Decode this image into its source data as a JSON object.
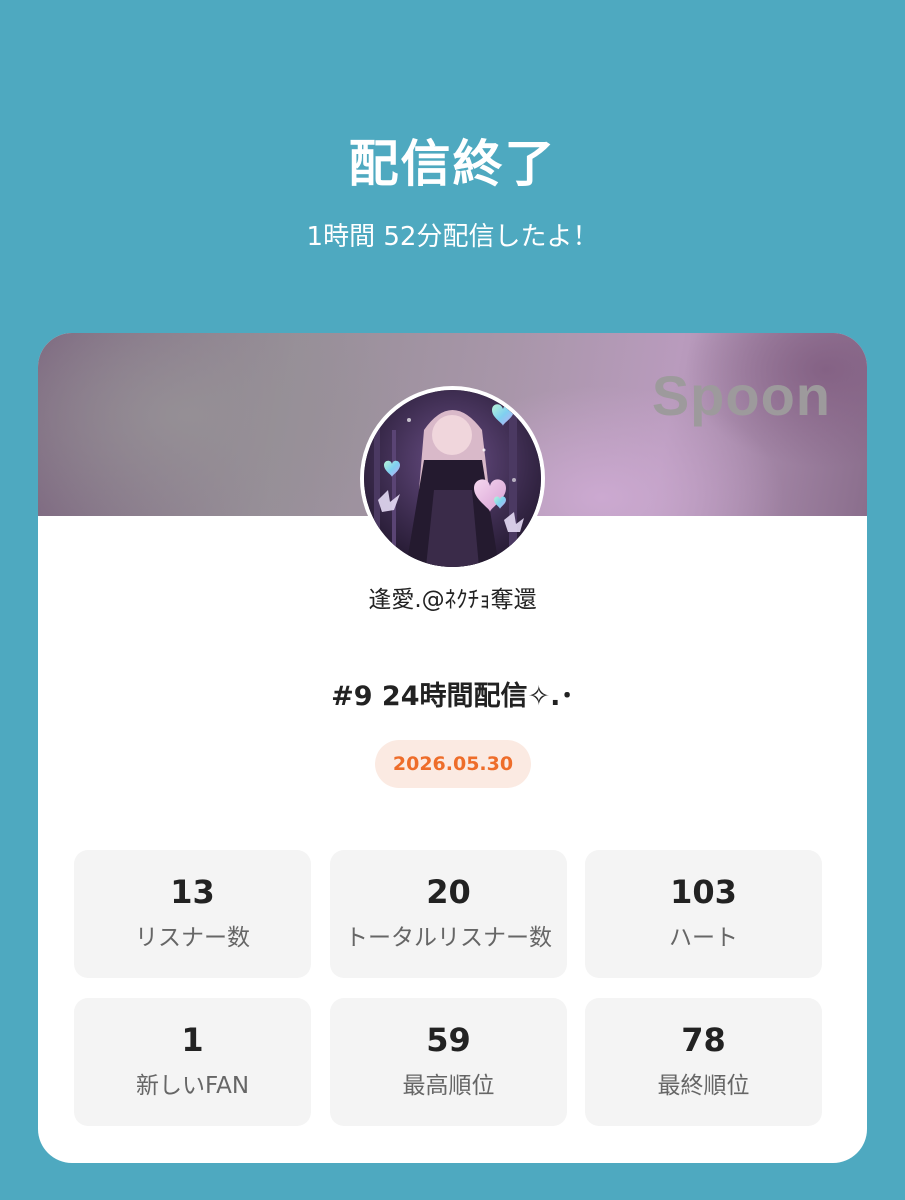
{
  "header": {
    "title": "配信終了",
    "duration_text": "1時間 52分配信したよ！"
  },
  "card": {
    "brand_text": "Spoon",
    "username": "逢愛.@ﾈｸﾁｮ奪還",
    "live_title": "#9 24時間配信✧.･",
    "date": "2026.05.30"
  },
  "stats": [
    {
      "value": "13",
      "label": "リスナー数"
    },
    {
      "value": "20",
      "label": "トータルリスナー数"
    },
    {
      "value": "103",
      "label": "ハート"
    },
    {
      "value": "1",
      "label": "新しいFAN"
    },
    {
      "value": "59",
      "label": "最高順位"
    },
    {
      "value": "78",
      "label": "最終順位"
    }
  ],
  "colors": {
    "background": "#4ea9c0",
    "card": "#ffffff",
    "date_text": "#ee6d2a",
    "date_badge": "#fbeae2",
    "stat_tile": "#f4f4f4"
  }
}
